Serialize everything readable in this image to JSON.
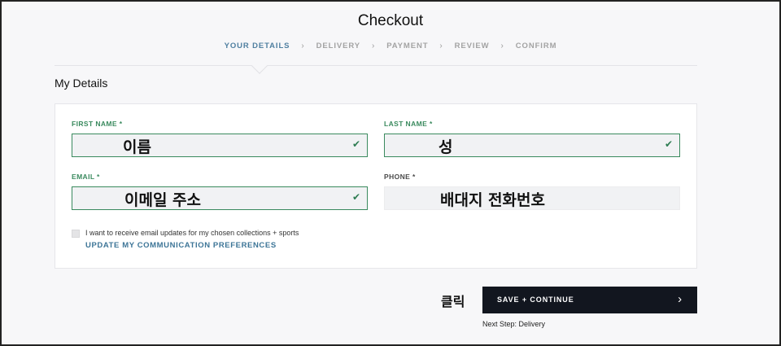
{
  "header": {
    "title": "Checkout",
    "steps": [
      {
        "label": "YOUR DETAILS",
        "active": true
      },
      {
        "label": "DELIVERY",
        "active": false
      },
      {
        "label": "PAYMENT",
        "active": false
      },
      {
        "label": "REVIEW",
        "active": false
      },
      {
        "label": "CONFIRM",
        "active": false
      }
    ],
    "separator": "›"
  },
  "section": {
    "title": "My Details"
  },
  "form": {
    "first_name": {
      "label": "FIRST NAME *",
      "value": "이름",
      "valid": true
    },
    "last_name": {
      "label": "LAST NAME *",
      "value": "성",
      "valid": true
    },
    "email": {
      "label": "EMAIL *",
      "value": "이메일 주소",
      "valid": true
    },
    "phone": {
      "label": "PHONE *",
      "value": "배대지 전화번호",
      "valid": false
    },
    "consent_text": "I want to receive email updates for my chosen collections + sports",
    "preferences_link": "UPDATE MY COMMUNICATION PREFERENCES",
    "check_glyph": "✔"
  },
  "actions": {
    "annotation": "클릭",
    "save_label": "SAVE + CONTINUE",
    "save_chevron": "›",
    "next_step": "Next Step: Delivery"
  },
  "colors": {
    "active_step": "#4f7fa0",
    "valid_green": "#3a8a5e",
    "button_bg": "#12161f",
    "link_blue": "#3d7597"
  }
}
